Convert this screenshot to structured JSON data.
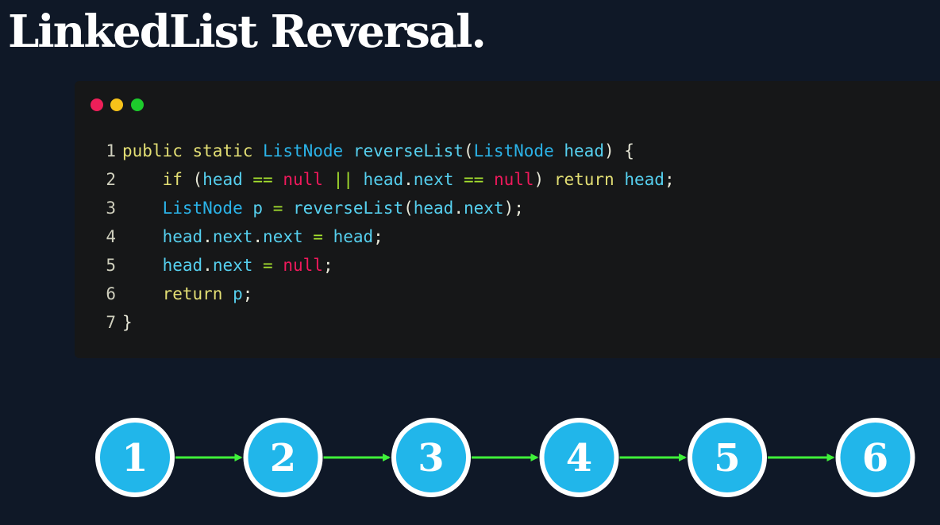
{
  "title": "LinkedList Reversal.",
  "window_dots": [
    {
      "name": "close-dot",
      "color": "#ee1f59"
    },
    {
      "name": "minimize-dot",
      "color": "#f6c21a"
    },
    {
      "name": "maximize-dot",
      "color": "#1dcc2c"
    }
  ],
  "code": {
    "lines": [
      {
        "number": "1",
        "indent": "",
        "tokens": [
          {
            "t": "public",
            "c": "kw"
          },
          {
            "t": " ",
            "c": "plain"
          },
          {
            "t": "static",
            "c": "kw"
          },
          {
            "t": " ",
            "c": "plain"
          },
          {
            "t": "ListNode",
            "c": "cls"
          },
          {
            "t": " ",
            "c": "plain"
          },
          {
            "t": "reverseList",
            "c": "id"
          },
          {
            "t": "(",
            "c": "punct"
          },
          {
            "t": "ListNode",
            "c": "cls"
          },
          {
            "t": " ",
            "c": "plain"
          },
          {
            "t": "head",
            "c": "id"
          },
          {
            "t": ") {",
            "c": "punct"
          }
        ]
      },
      {
        "number": "2",
        "indent": "    ",
        "tokens": [
          {
            "t": "if",
            "c": "kw"
          },
          {
            "t": " (",
            "c": "punct"
          },
          {
            "t": "head",
            "c": "id"
          },
          {
            "t": " ",
            "c": "plain"
          },
          {
            "t": "==",
            "c": "op"
          },
          {
            "t": " ",
            "c": "plain"
          },
          {
            "t": "null",
            "c": "null"
          },
          {
            "t": " ",
            "c": "plain"
          },
          {
            "t": "||",
            "c": "op"
          },
          {
            "t": " ",
            "c": "plain"
          },
          {
            "t": "head",
            "c": "id"
          },
          {
            "t": ".",
            "c": "punct"
          },
          {
            "t": "next",
            "c": "id"
          },
          {
            "t": " ",
            "c": "plain"
          },
          {
            "t": "==",
            "c": "op"
          },
          {
            "t": " ",
            "c": "plain"
          },
          {
            "t": "null",
            "c": "null"
          },
          {
            "t": ") ",
            "c": "punct"
          },
          {
            "t": "return",
            "c": "kw"
          },
          {
            "t": " ",
            "c": "plain"
          },
          {
            "t": "head",
            "c": "id"
          },
          {
            "t": ";",
            "c": "punct"
          }
        ]
      },
      {
        "number": "3",
        "indent": "    ",
        "tokens": [
          {
            "t": "ListNode",
            "c": "cls"
          },
          {
            "t": " ",
            "c": "plain"
          },
          {
            "t": "p",
            "c": "id"
          },
          {
            "t": " ",
            "c": "plain"
          },
          {
            "t": "=",
            "c": "op"
          },
          {
            "t": " ",
            "c": "plain"
          },
          {
            "t": "reverseList",
            "c": "id"
          },
          {
            "t": "(",
            "c": "punct"
          },
          {
            "t": "head",
            "c": "id"
          },
          {
            "t": ".",
            "c": "punct"
          },
          {
            "t": "next",
            "c": "id"
          },
          {
            "t": ");",
            "c": "punct"
          }
        ]
      },
      {
        "number": "4",
        "indent": "    ",
        "tokens": [
          {
            "t": "head",
            "c": "id"
          },
          {
            "t": ".",
            "c": "punct"
          },
          {
            "t": "next",
            "c": "id"
          },
          {
            "t": ".",
            "c": "punct"
          },
          {
            "t": "next",
            "c": "id"
          },
          {
            "t": " ",
            "c": "plain"
          },
          {
            "t": "=",
            "c": "op"
          },
          {
            "t": " ",
            "c": "plain"
          },
          {
            "t": "head",
            "c": "id"
          },
          {
            "t": ";",
            "c": "punct"
          }
        ]
      },
      {
        "number": "5",
        "indent": "    ",
        "tokens": [
          {
            "t": "head",
            "c": "id"
          },
          {
            "t": ".",
            "c": "punct"
          },
          {
            "t": "next",
            "c": "id"
          },
          {
            "t": " ",
            "c": "plain"
          },
          {
            "t": "=",
            "c": "op"
          },
          {
            "t": " ",
            "c": "plain"
          },
          {
            "t": "null",
            "c": "null"
          },
          {
            "t": ";",
            "c": "punct"
          }
        ]
      },
      {
        "number": "6",
        "indent": "    ",
        "tokens": [
          {
            "t": "return",
            "c": "kw"
          },
          {
            "t": " ",
            "c": "plain"
          },
          {
            "t": "p",
            "c": "id"
          },
          {
            "t": ";",
            "c": "punct"
          }
        ]
      },
      {
        "number": "7",
        "indent": "",
        "tokens": [
          {
            "t": "}",
            "c": "punct"
          }
        ]
      }
    ]
  },
  "linked_list": {
    "nodes": [
      "1",
      "2",
      "3",
      "4",
      "5",
      "6"
    ],
    "node_color": "#21b6ea",
    "node_border_color": "#ffffff",
    "arrow_color": "#3ff03a"
  }
}
